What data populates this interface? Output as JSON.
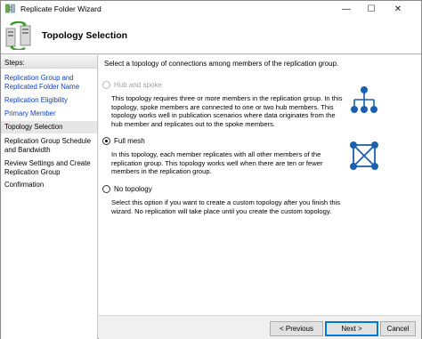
{
  "window": {
    "title": "Replicate Folder Wizard",
    "min_glyph": "—",
    "max_glyph": "☐",
    "close_glyph": "✕"
  },
  "header": {
    "title": "Topology Selection",
    "icon": "replication-wizard-icon"
  },
  "steps": {
    "label": "Steps:",
    "items": [
      {
        "label": "Replication Group and Replicated Folder Name",
        "state": "link"
      },
      {
        "label": "Replication Eligibility",
        "state": "link"
      },
      {
        "label": "Primary Member",
        "state": "link"
      },
      {
        "label": "Topology Selection",
        "state": "active"
      },
      {
        "label": "Replication Group Schedule and Bandwidth",
        "state": "plain"
      },
      {
        "label": "Review Settings and Create Replication Group",
        "state": "plain"
      },
      {
        "label": "Confirmation",
        "state": "plain"
      }
    ]
  },
  "main": {
    "intro": "Select a topology of connections among members of the replication group.",
    "options": [
      {
        "label": "Hub and spoke",
        "enabled": false,
        "selected": false,
        "description": "This topology requires three or more members in the replication group. In this topology, spoke members are connected to one or two hub members. This topology works well in publication scenarios where data originates from the hub member and replicates out to the spoke members.",
        "icon": "hub-and-spoke-icon"
      },
      {
        "label": "Full mesh",
        "enabled": true,
        "selected": true,
        "description": "In this topology, each member replicates with all other members of the replication group. This topology works well when there are ten or fewer members in the replication group.",
        "icon": "full-mesh-icon"
      },
      {
        "label": "No topology",
        "enabled": true,
        "selected": false,
        "description": "Select this option if you want to create a custom topology after you finish this wizard. No replication will take place until you create the custom topology."
      }
    ]
  },
  "footer": {
    "previous": "< Previous",
    "next": "Next >",
    "cancel": "Cancel"
  },
  "colors": {
    "accent": "#0078d7",
    "link": "#0b40c4",
    "icon_blue": "#1b5fae"
  }
}
